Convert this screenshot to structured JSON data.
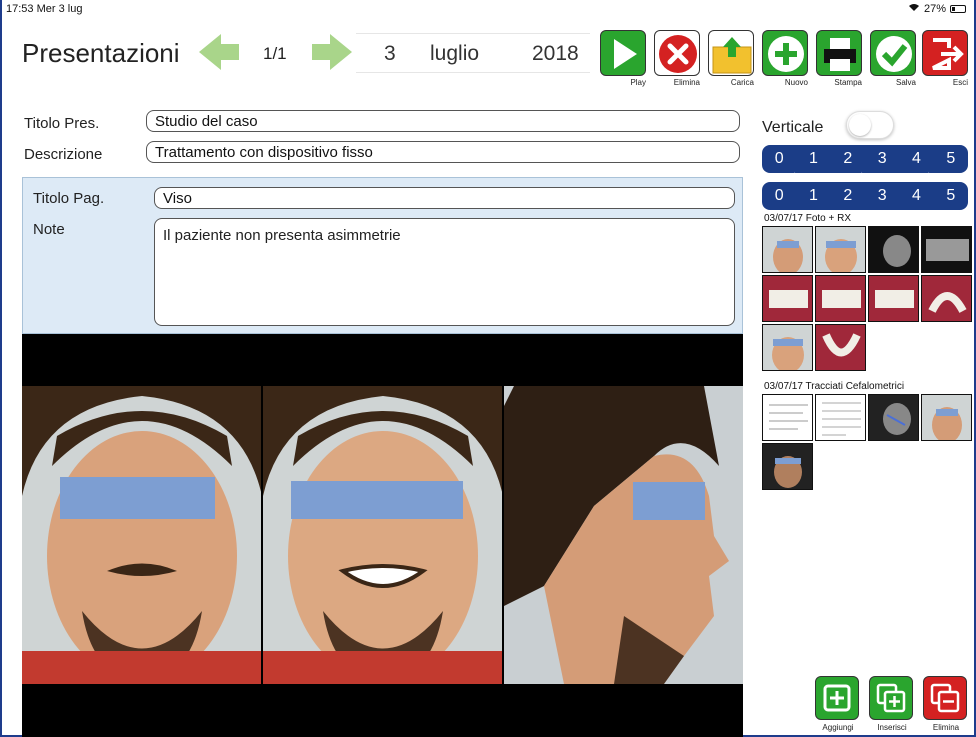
{
  "status": {
    "time_day": "17:53  Mer 3 lug",
    "battery": "27%"
  },
  "header": {
    "title": "Presentazioni",
    "page_counter": "1/1",
    "date": {
      "day": "3",
      "month": "luglio",
      "year": "2018"
    }
  },
  "toolbar": [
    {
      "label": "Play",
      "icon": "play-icon",
      "color": "#2aa52e"
    },
    {
      "label": "Elimina",
      "icon": "delete-icon",
      "color": "#d42121"
    },
    {
      "label": "Carica",
      "icon": "upload-folder-icon",
      "color": "#f2c12e"
    },
    {
      "label": "Nuovo",
      "icon": "plus-icon",
      "color": "#2aa52e"
    },
    {
      "label": "Stampa",
      "icon": "printer-icon",
      "color": "#2aa52e"
    },
    {
      "label": "Salva",
      "icon": "check-icon",
      "color": "#2aa52e"
    },
    {
      "label": "Esci",
      "icon": "exit-icon",
      "color": "#d42121"
    }
  ],
  "presentation": {
    "title_label": "Titolo Pres.",
    "title_value": "Studio del caso",
    "description_label": "Descrizione",
    "description_value": "Trattamento con dispositivo fisso"
  },
  "page": {
    "title_label": "Titolo Pag.",
    "title_value": "Viso",
    "notes_label": "Note",
    "notes_value": "Il paziente non presenta asimmetrie"
  },
  "sidebar": {
    "vertical_label": "Verticale",
    "vertical_on": false,
    "row1": [
      "0",
      "1",
      "2",
      "3",
      "4",
      "5"
    ],
    "row2": [
      "0",
      "1",
      "2",
      "3",
      "4",
      "5"
    ],
    "section1": "03/07/17 Foto + RX",
    "section2": "03/07/17 Tracciati Cefalometrici"
  },
  "actions": [
    {
      "label": "Aggiungi",
      "icon": "add-page-icon",
      "color": "#2aa52e"
    },
    {
      "label": "Inserisci",
      "icon": "insert-page-icon",
      "color": "#2aa52e"
    },
    {
      "label": "Elimina",
      "icon": "delete-page-icon",
      "color": "#d42121"
    }
  ],
  "colors": {
    "accent_blue": "#1b3d87",
    "panel_bg": "#ddeaf6",
    "arrow_green": "#a9d58a",
    "censor_blue": "#7d9ed2"
  }
}
